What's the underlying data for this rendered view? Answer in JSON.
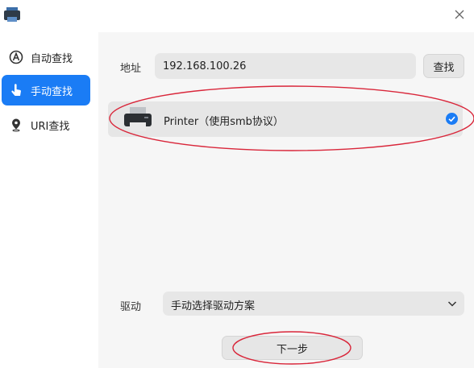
{
  "sidebar": {
    "items": [
      {
        "label": "自动查找",
        "icon": "auto-search-icon",
        "active": false
      },
      {
        "label": "手动查找",
        "icon": "hand-pointer-icon",
        "active": true
      },
      {
        "label": "URI查找",
        "icon": "location-pin-icon",
        "active": false
      }
    ]
  },
  "main": {
    "address_label": "地址",
    "address_value": "192.168.100.26",
    "search_label": "查找",
    "printers": [
      {
        "name": "Printer（使用smb协议）",
        "selected": true
      }
    ],
    "driver_label": "驱动",
    "driver_value": "手动选择驱动方案",
    "next_label": "下一步"
  },
  "colors": {
    "accent": "#1a7cf5",
    "annotation": "#d9263a"
  }
}
